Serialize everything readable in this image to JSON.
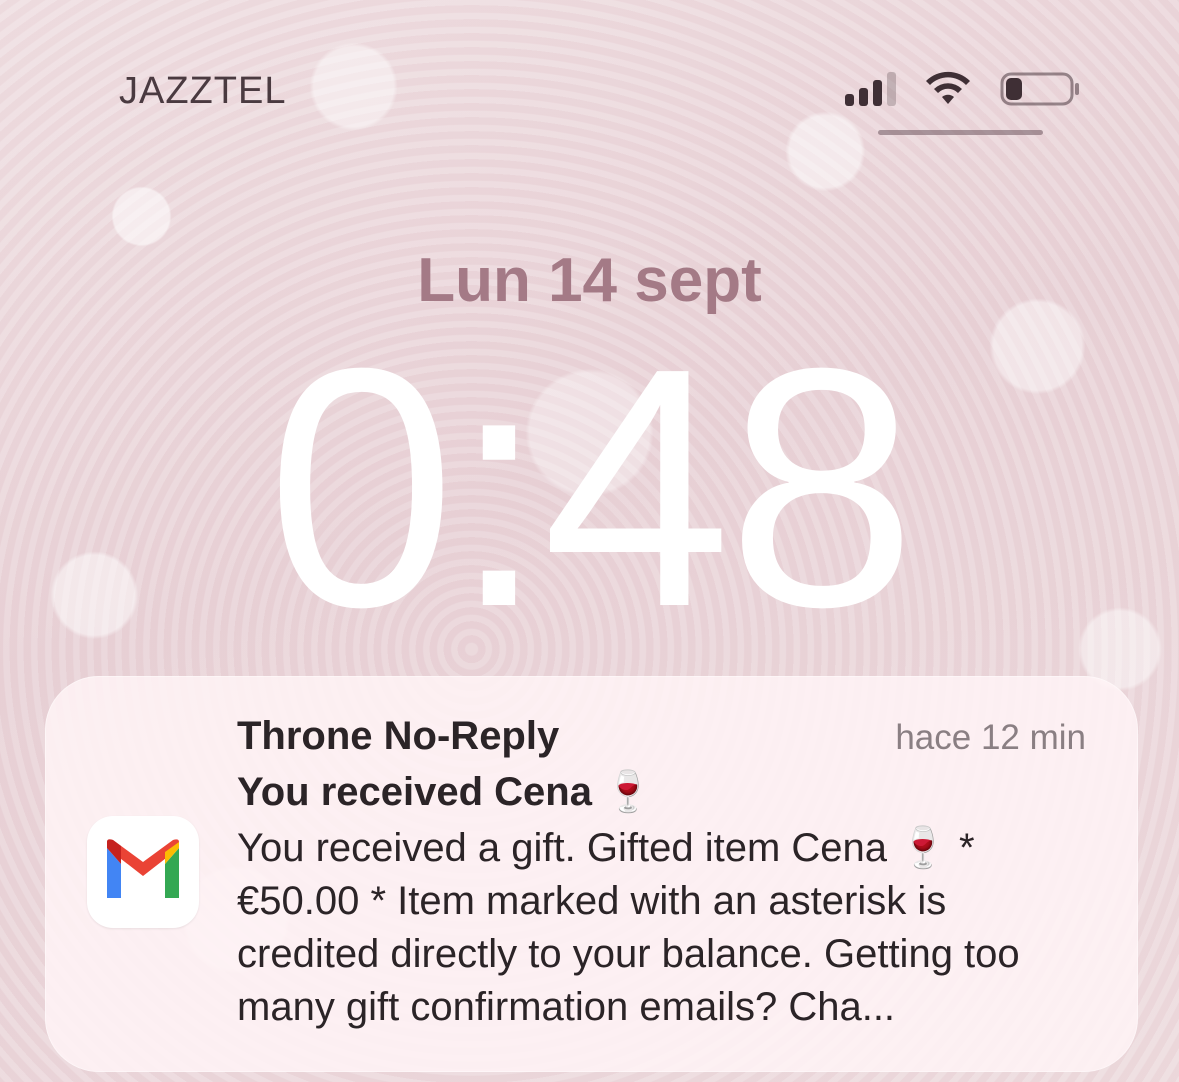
{
  "status_bar": {
    "carrier": "JAZZTEL",
    "signal_icon": "cellular-signal-icon",
    "wifi_icon": "wifi-icon",
    "battery_icon": "battery-icon",
    "battery_level": 0.25
  },
  "lock_screen": {
    "date": "Lun 14 sept",
    "time": "0:48"
  },
  "notification": {
    "app_icon": "gmail-icon",
    "sender": "Throne No-Reply",
    "time_ago": "hace 12 min",
    "subject": "You received Cena 🍷",
    "body": "You received a gift. Gifted item Cena 🍷 * €50.00 * Item marked with an asterisk is credited directly to your balance. Getting too many gift confirmation emails? Cha..."
  }
}
